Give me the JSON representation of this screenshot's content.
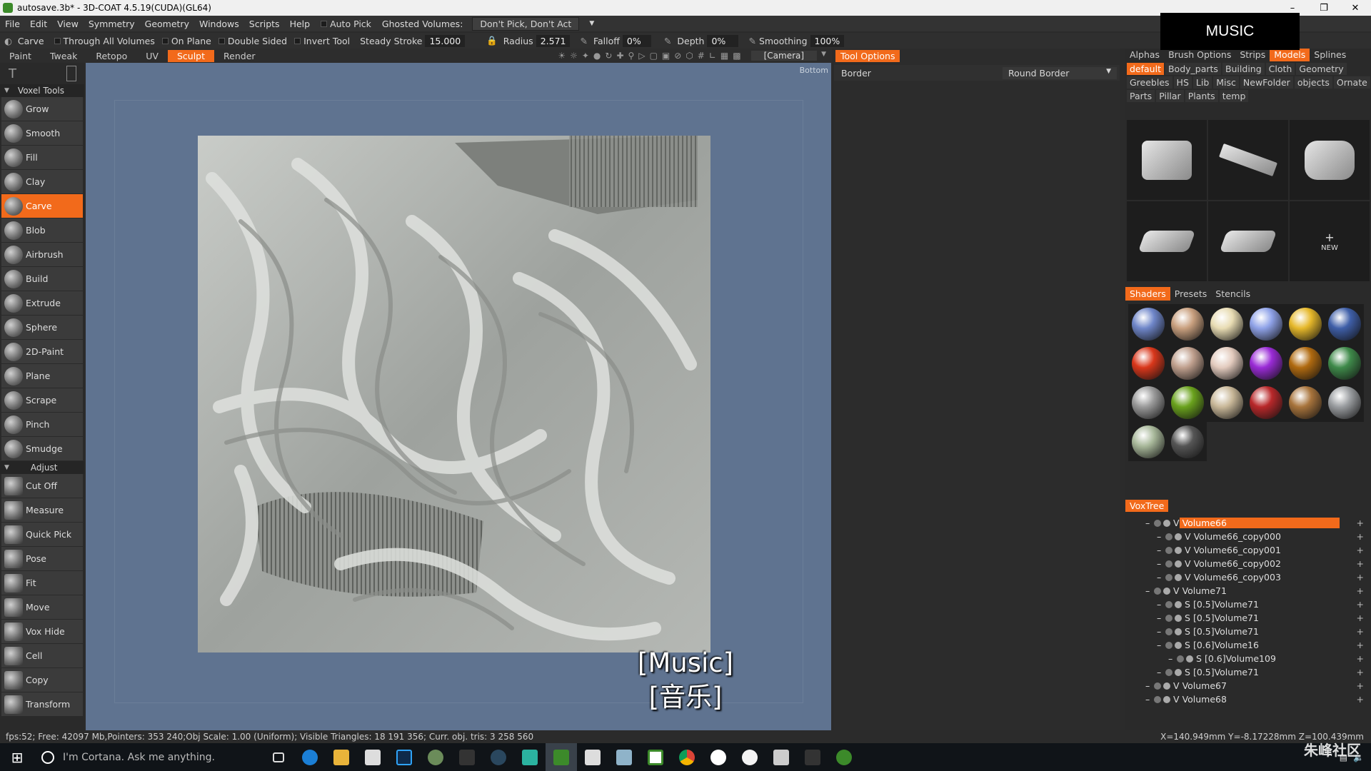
{
  "window": {
    "title": "autosave.3b* - 3D-COAT 4.5.19(CUDA)(GL64)"
  },
  "menu": {
    "items": [
      "File",
      "Edit",
      "View",
      "Symmetry",
      "Geometry",
      "Windows",
      "Scripts",
      "Help"
    ],
    "auto_pick": "Auto Pick",
    "ghosted_label": "Ghosted Volumes:",
    "ghosted_value": "Don't Pick, Don't Act"
  },
  "toolbar": {
    "tool": "Carve",
    "through_all": "Through All Volumes",
    "on_plane": "On Plane",
    "double_sided": "Double Sided",
    "invert_tool": "Invert Tool",
    "steady_label": "Steady Stroke",
    "steady_value": "15.000",
    "radius_label": "Radius",
    "radius_value": "2.571",
    "falloff_label": "Falloff",
    "falloff_value": "0%",
    "depth_label": "Depth",
    "depth_value": "0%",
    "smoothing_label": "Smoothing",
    "smoothing_value": "100%"
  },
  "room_tabs": [
    "Paint",
    "Tweak",
    "Retopo",
    "UV",
    "Sculpt",
    "Render"
  ],
  "active_room": "Sculpt",
  "camera": "[Camera]",
  "viewport": {
    "view_label": "Bottom"
  },
  "voxel_tools": {
    "header": "Voxel Tools",
    "items": [
      "Grow",
      "Smooth",
      "Fill",
      "Clay",
      "Carve",
      "Blob",
      "Airbrush",
      "Build",
      "Extrude",
      "Sphere",
      "2D-Paint",
      "Plane",
      "Scrape",
      "Pinch",
      "Smudge"
    ]
  },
  "adjust": {
    "header": "Adjust",
    "items": [
      "Cut Off",
      "Measure",
      "Quick Pick",
      "Pose",
      "Fit",
      "Move",
      "Vox Hide",
      "Cell",
      "Copy",
      "Transform"
    ]
  },
  "tool_options": {
    "header": "Tool Options",
    "border_label": "Border",
    "border_value": "Round Border"
  },
  "right_tabs": [
    "Alphas",
    "Brush Options",
    "Strips",
    "Models",
    "Splines"
  ],
  "model_folders": [
    "default",
    "Body_parts",
    "Building",
    "Cloth",
    "Geometry",
    "Greebles",
    "HS",
    "Lib",
    "Misc",
    "NewFolder",
    "objects",
    "Ornate",
    "Parts",
    "Pillar",
    "Plants",
    "temp"
  ],
  "new_label": "NEW",
  "shader_tabs": [
    "Shaders",
    "Presets",
    "Stencils"
  ],
  "shader_colors": [
    "#6f86c9",
    "#c9a07f",
    "#e8dcb3",
    "#8fa2e8",
    "#e6b82a",
    "#3f5fa8",
    "#d9371b",
    "#c0a08e",
    "#e3cbbe",
    "#9a2bd6",
    "#b06a10",
    "#3f8a4a",
    "#9a9a9a",
    "#6aa21d",
    "#c9b899",
    "#b8282a",
    "#a8743c",
    "#9a9da0",
    "#a8b89a",
    "#555555"
  ],
  "voxtree": {
    "header": "VoxTree",
    "items": [
      {
        "type": "V",
        "name": "Volume66"
      },
      {
        "type": "V",
        "name": "Volume66_copy000"
      },
      {
        "type": "V",
        "name": "Volume66_copy001"
      },
      {
        "type": "V",
        "name": "Volume66_copy002"
      },
      {
        "type": "V",
        "name": "Volume66_copy003"
      },
      {
        "type": "V",
        "name": "Volume71"
      },
      {
        "type": "S",
        "name": "[0.5]Volume71"
      },
      {
        "type": "S",
        "name": "[0.5]Volume71"
      },
      {
        "type": "S",
        "name": "[0.5]Volume71"
      },
      {
        "type": "S",
        "name": "[0.6]Volume16"
      },
      {
        "type": "S",
        "name": "[0.6]Volume109"
      },
      {
        "type": "S",
        "name": "[0.5]Volume71"
      },
      {
        "type": "V",
        "name": "Volume67"
      },
      {
        "type": "V",
        "name": "Volume68"
      }
    ]
  },
  "status": {
    "text": "fps:52;   Free: 42097 Mb,Pointers: 353 240;Obj Scale: 1.00 (Uniform); Visible Triangles: 18 191 356; Curr. obj. tris: 3 258 560",
    "coords": "X=140.949mm  Y=-8.17228mm  Z=100.439mm"
  },
  "overlay": {
    "music_box": "MUSIC",
    "subtitle_en": "[Music]",
    "subtitle_zh": "[音乐]"
  },
  "taskbar": {
    "search": "I'm Cortana. Ask me anything.",
    "watermark": "朱峰社区"
  }
}
